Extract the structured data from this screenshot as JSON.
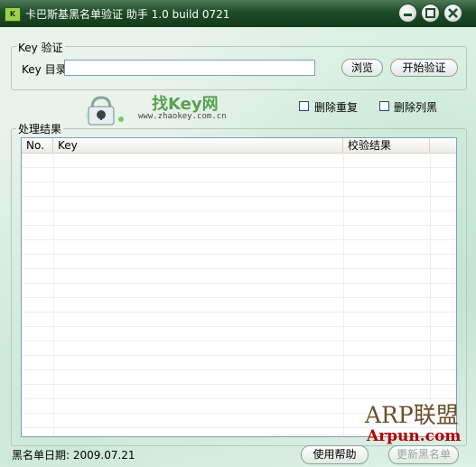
{
  "titlebar": {
    "title": "卡巴斯基黑名单验证 助手 1.0 build 0721"
  },
  "key_group": {
    "title": "Key 验证",
    "dir_label": "Key 目录",
    "dir_value": "",
    "browse_label": "浏览",
    "start_label": "开始验证"
  },
  "logo": {
    "brand": "找Key网",
    "url": "www.zhaokey.com.cn"
  },
  "options": {
    "delete_dup": "删除重复",
    "delete_blacklist": "删除列黑"
  },
  "results": {
    "title": "处理结果",
    "columns": [
      "No.",
      "Key",
      "校验结果"
    ]
  },
  "footer": {
    "blacklist_date": "黑名单日期: 2009.07.21",
    "help_label": "使用帮助",
    "update_label": "更新黑名单"
  },
  "watermark": {
    "line1": "ARP联盟",
    "line2": "Arpun.com"
  },
  "colors": {
    "titlebar": "#1f4d2a",
    "accent": "#5aa050",
    "watermark_text": "#6b4e2a",
    "watermark_url": "#b30000"
  }
}
